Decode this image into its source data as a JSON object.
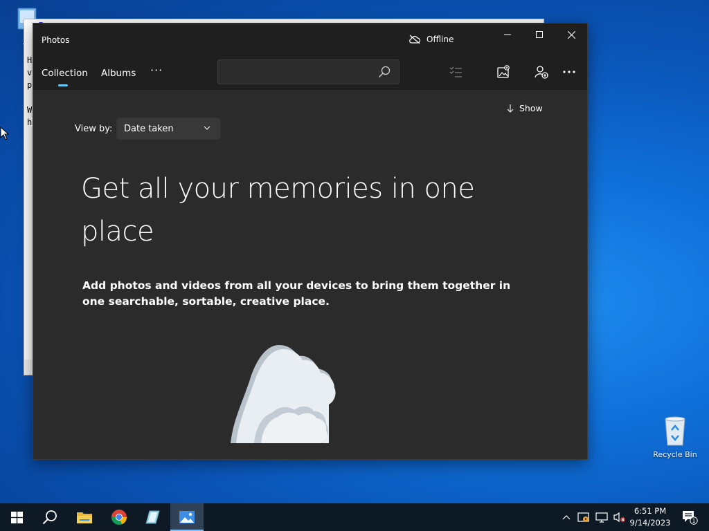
{
  "desktop": {
    "icons": [
      {
        "label": "Th",
        "icon": "this-pc-icon"
      },
      {
        "label": "Recycle Bin",
        "icon": "recycle-bin-icon"
      }
    ],
    "background_window_text": [
      "H",
      "v",
      "p",
      "W",
      "h"
    ],
    "background_window_title_fragment": "F"
  },
  "photos_window": {
    "title": "Photos",
    "status": "Offline",
    "controls": {
      "minimize": "minimize-icon",
      "maximize": "maximize-icon",
      "close": "close-icon"
    },
    "tabs": [
      {
        "label": "Collection",
        "selected": true
      },
      {
        "label": "Albums",
        "selected": false
      }
    ],
    "more_tabs": "···",
    "search": {
      "value": "",
      "placeholder": ""
    },
    "toolbar_icons": [
      "select-icon",
      "import-icon",
      "add-people-icon",
      "more-icon"
    ],
    "show_label": "Show",
    "view_by": {
      "label": "View by:",
      "value": "Date taken"
    },
    "hero": {
      "title": "Get all your memories in one place",
      "body": "Add photos and videos from all your devices to bring them together in one searchable, sortable, creative place."
    },
    "accent": "#60cdff"
  },
  "taskbar": {
    "items": [
      "start-icon",
      "search-icon",
      "file-explorer-icon",
      "chrome-icon",
      "generic-app-icon",
      "photos-icon"
    ],
    "active_item": "photos-icon",
    "tray_icons": [
      "chevron-up-icon",
      "security-icon",
      "network-icon",
      "volume-muted-icon"
    ],
    "time": "6:51 PM",
    "date": "9/14/2023",
    "notification_count": "1"
  }
}
